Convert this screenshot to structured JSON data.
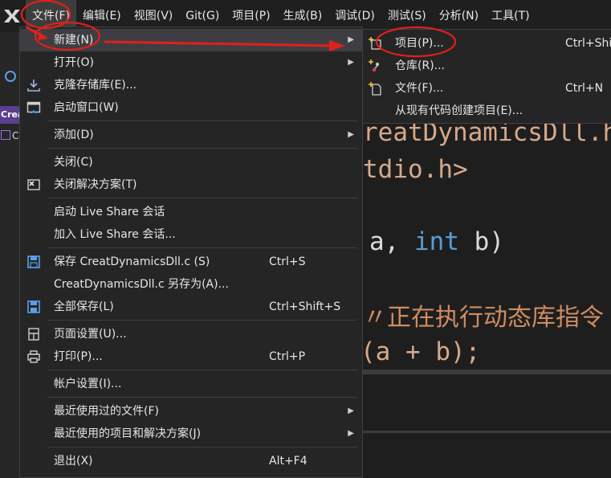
{
  "menubar": {
    "items": [
      {
        "label": "文件(F)",
        "active": true
      },
      {
        "label": "编辑(E)"
      },
      {
        "label": "视图(V)"
      },
      {
        "label": "Git(G)"
      },
      {
        "label": "项目(P)"
      },
      {
        "label": "生成(B)"
      },
      {
        "label": "调试(D)"
      },
      {
        "label": "测试(S)"
      },
      {
        "label": "分析(N)"
      },
      {
        "label": "工具(T)"
      }
    ]
  },
  "sidebar": {
    "tab_label": "Creat",
    "tab2_label": "C"
  },
  "file_menu": {
    "new": "新建(N)",
    "open": "打开(O)",
    "clone": "克隆存储库(E)...",
    "start_window": "启动窗口(W)",
    "add": "添加(D)",
    "close": "关闭(C)",
    "close_solution": "关闭解决方案(T)",
    "live_share_start": "启动 Live Share 会话",
    "live_share_join": "加入 Live Share 会话...",
    "save": "保存 CreatDynamicsDll.c (S)",
    "save_sc": "Ctrl+S",
    "save_as": "CreatDynamicsDll.c 另存为(A)...",
    "save_all": "全部保存(L)",
    "save_all_sc": "Ctrl+Shift+S",
    "page_setup": "页面设置(U)...",
    "print": "打印(P)...",
    "print_sc": "Ctrl+P",
    "account": "帐户设置(I)...",
    "recent_files": "最近使用过的文件(F)",
    "recent_projects": "最近使用的项目和解决方案(J)",
    "exit": "退出(X)",
    "exit_sc": "Alt+F4"
  },
  "new_submenu": {
    "project": "项目(P)...",
    "project_sc": "Ctrl+Shi",
    "repository": "仓库(R)...",
    "file": "文件(F)...",
    "file_sc": "Ctrl+N",
    "from_existing": "从现有代码创建项目(E)..."
  },
  "editor": {
    "line1": "reatDynamicsDll.h",
    "line2": "tdio.h>",
    "line3_a": "a, ",
    "line3_kw": "int",
    "line3_b": " b)",
    "line4": "〃正在执行动态库指令",
    "line5": "(a + b);"
  },
  "colors": {
    "annotation": "#e0201c",
    "accent": "#569cd6",
    "menu_bg": "#252526"
  }
}
